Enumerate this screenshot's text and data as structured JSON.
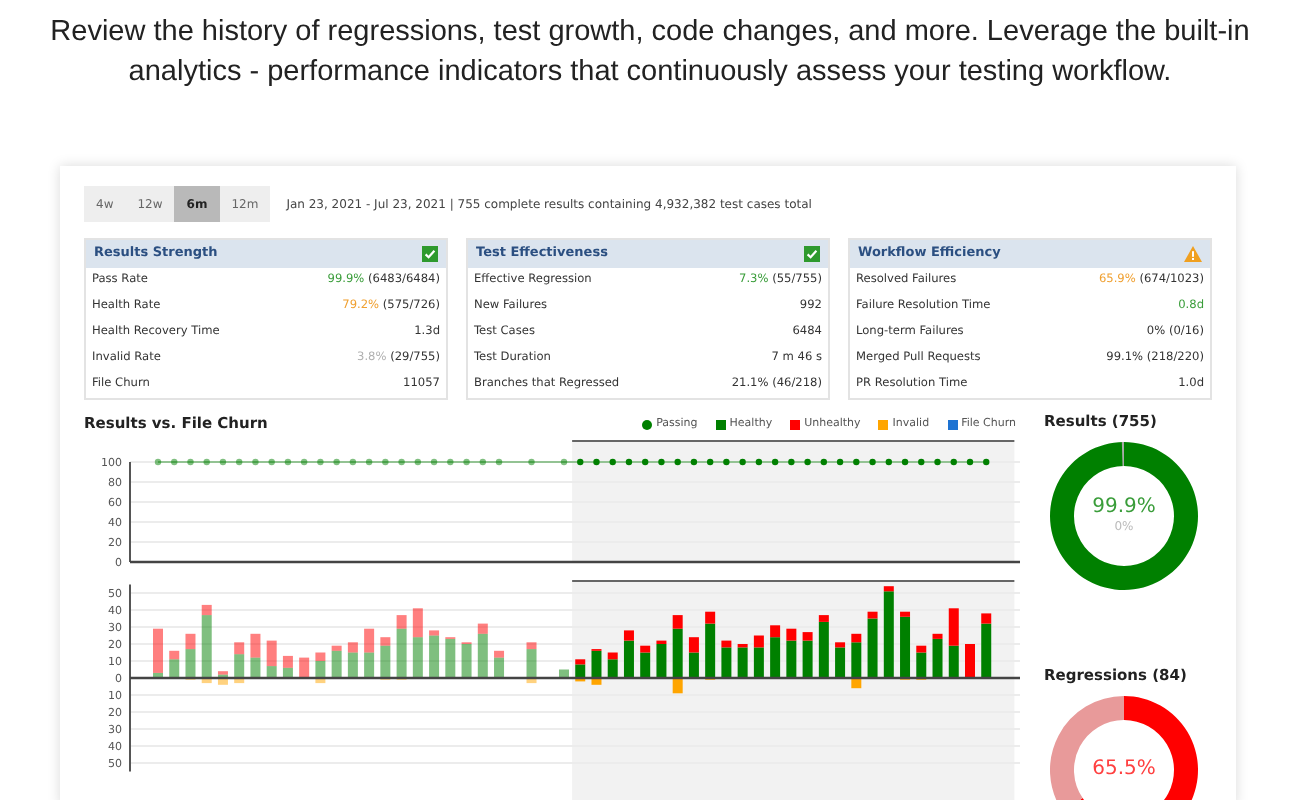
{
  "intro": "Review the history of regressions, test growth, code changes, and more. Leverage the built-in analytics - performance indicators that continuously assess your testing workflow.",
  "periods": [
    {
      "label": "4w",
      "selected": false
    },
    {
      "label": "12w",
      "selected": false
    },
    {
      "label": "6m",
      "selected": true
    },
    {
      "label": "12m",
      "selected": false
    }
  ],
  "summary": "Jan 23, 2021 - Jul 23, 2021 | 755 complete results containing 4,932,382 test cases total",
  "panels": [
    {
      "title": "Results Strength",
      "warning": false,
      "rows": [
        {
          "label": "Pass Rate",
          "value": "99.9%",
          "color": "#3a9d3a",
          "detail": "(6483/6484)"
        },
        {
          "label": "Health Rate",
          "value": "79.2%",
          "color": "#f0a030",
          "detail": "(575/726)"
        },
        {
          "label": "Health Recovery Time",
          "value": "1.3d",
          "color": "#333333"
        },
        {
          "label": "Invalid Rate",
          "value": "3.8%",
          "color": "#b0b0b0",
          "detail": "(29/755)"
        },
        {
          "label": "File Churn",
          "value": "11057",
          "color": "#333333"
        }
      ]
    },
    {
      "title": "Test Effectiveness",
      "warning": false,
      "rows": [
        {
          "label": "Effective Regression",
          "value": "7.3%",
          "color": "#3a9d3a",
          "detail": "(55/755)"
        },
        {
          "label": "New Failures",
          "value": "992",
          "color": "#333333"
        },
        {
          "label": "Test Cases",
          "value": "6484",
          "color": "#333333"
        },
        {
          "label": "Test Duration",
          "value": "7 m 46 s",
          "color": "#333333"
        },
        {
          "label": "Branches that Regressed",
          "value": "21.1% (46/218)",
          "color": "#333333"
        }
      ]
    },
    {
      "title": "Workflow Efficiency",
      "warning": true,
      "rows": [
        {
          "label": "Resolved Failures",
          "value": "65.9%",
          "color": "#f0a030",
          "detail": "(674/1023)"
        },
        {
          "label": "Failure Resolution Time",
          "value": "0.8d",
          "color": "#3a9d3a"
        },
        {
          "label": "Long-term Failures",
          "value": "0% (0/16)",
          "color": "#333333"
        },
        {
          "label": "Merged Pull Requests",
          "value": "99.1% (218/220)",
          "color": "#333333"
        },
        {
          "label": "PR Resolution Time",
          "value": "1.0d",
          "color": "#333333"
        }
      ]
    }
  ],
  "results_chart": {
    "title": "Results vs. File Churn",
    "legend_extra": [
      {
        "label": "File Churn",
        "color": "#1e73d2"
      }
    ],
    "passing_chart": {
      "chart_data": {
        "type": "line",
        "grid": true,
        "ylim": [
          0,
          100
        ],
        "yticks": [
          0,
          20,
          40,
          60,
          80,
          100
        ],
        "series": [
          {
            "name": "Passing",
            "color": "#008000",
            "marker": "circle",
            "values": [
              100,
              100,
              100,
              100,
              100,
              100,
              100,
              100,
              100,
              100,
              100,
              100,
              100,
              100,
              100,
              100,
              100,
              100,
              100,
              100,
              100,
              100,
              null,
              100,
              null,
              100,
              100,
              100,
              100,
              100,
              100,
              100,
              100,
              100,
              100,
              100,
              100,
              100,
              100,
              100,
              100,
              100,
              100,
              100,
              100,
              100,
              100,
              100,
              100,
              100,
              100,
              100
            ]
          }
        ]
      }
    },
    "churn_chart": {
      "chart_data": {
        "type": "bar",
        "stacked": true,
        "grid": true,
        "ylim": [
          -55,
          55
        ],
        "yticks": [
          50,
          40,
          30,
          20,
          10,
          0,
          {
            "value": -10,
            "label": "10"
          },
          {
            "value": -20,
            "label": "20"
          },
          {
            "value": -30,
            "label": "30"
          },
          {
            "value": -40,
            "label": "40"
          },
          {
            "value": -50,
            "label": "50"
          }
        ],
        "series": [
          {
            "name": "Healthy",
            "color": "#008000",
            "values": [
              3,
              11,
              17,
              37,
              2,
              14,
              12,
              7,
              6,
              0,
              10,
              16,
              15,
              15,
              19,
              29,
              24,
              25,
              23,
              20,
              26,
              12,
              null,
              17,
              null,
              5,
              8,
              16,
              11,
              22,
              15,
              20,
              29,
              15,
              32,
              18,
              18,
              18,
              24,
              22,
              22,
              33,
              18,
              21,
              35,
              51,
              36,
              15,
              23,
              19,
              0,
              32
            ]
          },
          {
            "name": "Unhealthy",
            "color": "#ff0000",
            "values": [
              26,
              5,
              9,
              6,
              2,
              7,
              14,
              15,
              7,
              12,
              5,
              3,
              6,
              14,
              5,
              8,
              17,
              3,
              1,
              1,
              6,
              4,
              null,
              4,
              null,
              0,
              3,
              1,
              4,
              6,
              4,
              2,
              8,
              9,
              7,
              4,
              2,
              7,
              7,
              7,
              5,
              4,
              3,
              5,
              4,
              3,
              3,
              4,
              3,
              22,
              20,
              6
            ]
          },
          {
            "name": "Invalid",
            "color": "#ffa500",
            "values": [
              0,
              0,
              -1,
              -3,
              -4,
              -3,
              0,
              0,
              0,
              0,
              -3,
              0,
              0,
              0,
              -1,
              -1,
              0,
              0,
              0,
              0,
              0,
              0,
              null,
              -3,
              null,
              0,
              -2,
              -4,
              0,
              0,
              0,
              0,
              -9,
              0,
              -1,
              0,
              0,
              0,
              0,
              0,
              0,
              0,
              0,
              -6,
              0,
              0,
              -1,
              -1,
              0,
              0,
              0,
              0
            ]
          }
        ]
      }
    }
  },
  "donuts": [
    {
      "title": "Results (755)",
      "center_value": "99.9%",
      "center_sub": "0%",
      "chart_data": {
        "type": "donut",
        "values": [
          99.9,
          0.1
        ]
      }
    },
    {
      "title": "Regressions (84)",
      "center_value": "65.5%",
      "chart_data": {
        "type": "donut",
        "values": [
          65.5,
          34.5
        ]
      }
    }
  ]
}
